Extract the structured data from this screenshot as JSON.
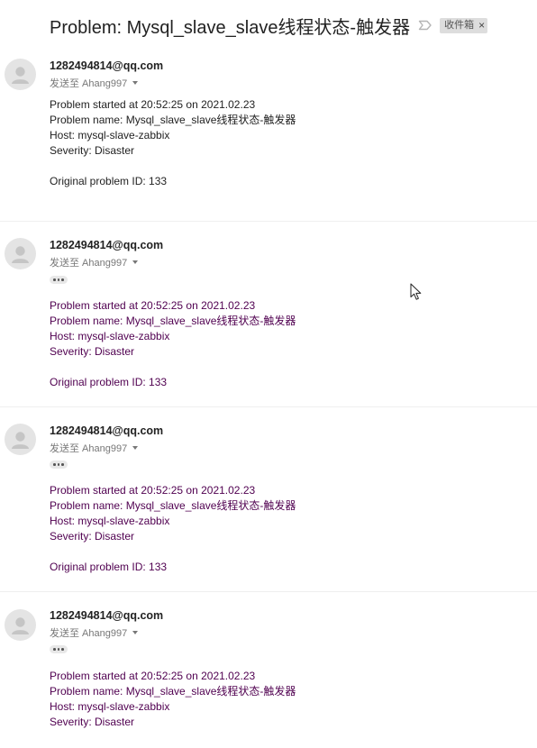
{
  "subject": {
    "title": "Problem: Mysql_slave_slave线程状态-触发器",
    "important_icon": "importance-marker-icon",
    "label": "收件箱",
    "label_remove": "×"
  },
  "messages": [
    {
      "sender": "1282494814@qq.com",
      "recipient": "发送至 Ahang997",
      "collapsed_quote": false,
      "lines": [
        "Problem started at 20:52:25 on 2021.02.23",
        "Problem name: Mysql_slave_slave线程状态-触发器",
        "Host: mysql-slave-zabbix",
        "Severity: Disaster",
        "Original problem ID: 133"
      ]
    },
    {
      "sender": "1282494814@qq.com",
      "recipient": "发送至 Ahang997",
      "collapsed_quote": true,
      "lines": [
        "Problem started at 20:52:25 on 2021.02.23",
        "Problem name: Mysql_slave_slave线程状态-触发器",
        "Host: mysql-slave-zabbix",
        "Severity: Disaster",
        "Original problem ID: 133"
      ]
    },
    {
      "sender": "1282494814@qq.com",
      "recipient": "发送至 Ahang997",
      "collapsed_quote": true,
      "lines": [
        "Problem started at 20:52:25 on 2021.02.23",
        "Problem name: Mysql_slave_slave线程状态-触发器",
        "Host: mysql-slave-zabbix",
        "Severity: Disaster",
        "Original problem ID: 133"
      ]
    },
    {
      "sender": "1282494814@qq.com",
      "recipient": "发送至 Ahang997",
      "collapsed_quote": true,
      "lines": [
        "Problem started at 20:52:25 on 2021.02.23",
        "Problem name: Mysql_slave_slave线程状态-触发器",
        "Host: mysql-slave-zabbix",
        "Severity: Disaster"
      ]
    }
  ],
  "colors": {
    "quoted_text": "#500050",
    "normal_text": "#222222",
    "meta_text": "#777777",
    "label_bg": "#dddddd"
  }
}
